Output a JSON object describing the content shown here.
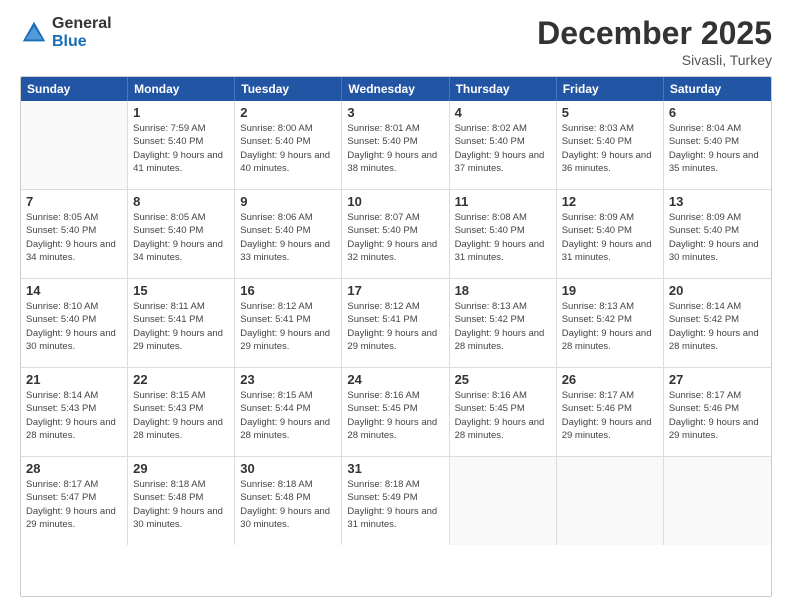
{
  "header": {
    "logo_general": "General",
    "logo_blue": "Blue",
    "month_title": "December 2025",
    "location": "Sivasli, Turkey"
  },
  "weekdays": [
    "Sunday",
    "Monday",
    "Tuesday",
    "Wednesday",
    "Thursday",
    "Friday",
    "Saturday"
  ],
  "weeks": [
    [
      {
        "day": "",
        "sunrise": "",
        "sunset": "",
        "daylight": ""
      },
      {
        "day": "1",
        "sunrise": "Sunrise: 7:59 AM",
        "sunset": "Sunset: 5:40 PM",
        "daylight": "Daylight: 9 hours and 41 minutes."
      },
      {
        "day": "2",
        "sunrise": "Sunrise: 8:00 AM",
        "sunset": "Sunset: 5:40 PM",
        "daylight": "Daylight: 9 hours and 40 minutes."
      },
      {
        "day": "3",
        "sunrise": "Sunrise: 8:01 AM",
        "sunset": "Sunset: 5:40 PM",
        "daylight": "Daylight: 9 hours and 38 minutes."
      },
      {
        "day": "4",
        "sunrise": "Sunrise: 8:02 AM",
        "sunset": "Sunset: 5:40 PM",
        "daylight": "Daylight: 9 hours and 37 minutes."
      },
      {
        "day": "5",
        "sunrise": "Sunrise: 8:03 AM",
        "sunset": "Sunset: 5:40 PM",
        "daylight": "Daylight: 9 hours and 36 minutes."
      },
      {
        "day": "6",
        "sunrise": "Sunrise: 8:04 AM",
        "sunset": "Sunset: 5:40 PM",
        "daylight": "Daylight: 9 hours and 35 minutes."
      }
    ],
    [
      {
        "day": "7",
        "sunrise": "Sunrise: 8:05 AM",
        "sunset": "Sunset: 5:40 PM",
        "daylight": "Daylight: 9 hours and 34 minutes."
      },
      {
        "day": "8",
        "sunrise": "Sunrise: 8:05 AM",
        "sunset": "Sunset: 5:40 PM",
        "daylight": "Daylight: 9 hours and 34 minutes."
      },
      {
        "day": "9",
        "sunrise": "Sunrise: 8:06 AM",
        "sunset": "Sunset: 5:40 PM",
        "daylight": "Daylight: 9 hours and 33 minutes."
      },
      {
        "day": "10",
        "sunrise": "Sunrise: 8:07 AM",
        "sunset": "Sunset: 5:40 PM",
        "daylight": "Daylight: 9 hours and 32 minutes."
      },
      {
        "day": "11",
        "sunrise": "Sunrise: 8:08 AM",
        "sunset": "Sunset: 5:40 PM",
        "daylight": "Daylight: 9 hours and 31 minutes."
      },
      {
        "day": "12",
        "sunrise": "Sunrise: 8:09 AM",
        "sunset": "Sunset: 5:40 PM",
        "daylight": "Daylight: 9 hours and 31 minutes."
      },
      {
        "day": "13",
        "sunrise": "Sunrise: 8:09 AM",
        "sunset": "Sunset: 5:40 PM",
        "daylight": "Daylight: 9 hours and 30 minutes."
      }
    ],
    [
      {
        "day": "14",
        "sunrise": "Sunrise: 8:10 AM",
        "sunset": "Sunset: 5:40 PM",
        "daylight": "Daylight: 9 hours and 30 minutes."
      },
      {
        "day": "15",
        "sunrise": "Sunrise: 8:11 AM",
        "sunset": "Sunset: 5:41 PM",
        "daylight": "Daylight: 9 hours and 29 minutes."
      },
      {
        "day": "16",
        "sunrise": "Sunrise: 8:12 AM",
        "sunset": "Sunset: 5:41 PM",
        "daylight": "Daylight: 9 hours and 29 minutes."
      },
      {
        "day": "17",
        "sunrise": "Sunrise: 8:12 AM",
        "sunset": "Sunset: 5:41 PM",
        "daylight": "Daylight: 9 hours and 29 minutes."
      },
      {
        "day": "18",
        "sunrise": "Sunrise: 8:13 AM",
        "sunset": "Sunset: 5:42 PM",
        "daylight": "Daylight: 9 hours and 28 minutes."
      },
      {
        "day": "19",
        "sunrise": "Sunrise: 8:13 AM",
        "sunset": "Sunset: 5:42 PM",
        "daylight": "Daylight: 9 hours and 28 minutes."
      },
      {
        "day": "20",
        "sunrise": "Sunrise: 8:14 AM",
        "sunset": "Sunset: 5:42 PM",
        "daylight": "Daylight: 9 hours and 28 minutes."
      }
    ],
    [
      {
        "day": "21",
        "sunrise": "Sunrise: 8:14 AM",
        "sunset": "Sunset: 5:43 PM",
        "daylight": "Daylight: 9 hours and 28 minutes."
      },
      {
        "day": "22",
        "sunrise": "Sunrise: 8:15 AM",
        "sunset": "Sunset: 5:43 PM",
        "daylight": "Daylight: 9 hours and 28 minutes."
      },
      {
        "day": "23",
        "sunrise": "Sunrise: 8:15 AM",
        "sunset": "Sunset: 5:44 PM",
        "daylight": "Daylight: 9 hours and 28 minutes."
      },
      {
        "day": "24",
        "sunrise": "Sunrise: 8:16 AM",
        "sunset": "Sunset: 5:45 PM",
        "daylight": "Daylight: 9 hours and 28 minutes."
      },
      {
        "day": "25",
        "sunrise": "Sunrise: 8:16 AM",
        "sunset": "Sunset: 5:45 PM",
        "daylight": "Daylight: 9 hours and 28 minutes."
      },
      {
        "day": "26",
        "sunrise": "Sunrise: 8:17 AM",
        "sunset": "Sunset: 5:46 PM",
        "daylight": "Daylight: 9 hours and 29 minutes."
      },
      {
        "day": "27",
        "sunrise": "Sunrise: 8:17 AM",
        "sunset": "Sunset: 5:46 PM",
        "daylight": "Daylight: 9 hours and 29 minutes."
      }
    ],
    [
      {
        "day": "28",
        "sunrise": "Sunrise: 8:17 AM",
        "sunset": "Sunset: 5:47 PM",
        "daylight": "Daylight: 9 hours and 29 minutes."
      },
      {
        "day": "29",
        "sunrise": "Sunrise: 8:18 AM",
        "sunset": "Sunset: 5:48 PM",
        "daylight": "Daylight: 9 hours and 30 minutes."
      },
      {
        "day": "30",
        "sunrise": "Sunrise: 8:18 AM",
        "sunset": "Sunset: 5:48 PM",
        "daylight": "Daylight: 9 hours and 30 minutes."
      },
      {
        "day": "31",
        "sunrise": "Sunrise: 8:18 AM",
        "sunset": "Sunset: 5:49 PM",
        "daylight": "Daylight: 9 hours and 31 minutes."
      },
      {
        "day": "",
        "sunrise": "",
        "sunset": "",
        "daylight": ""
      },
      {
        "day": "",
        "sunrise": "",
        "sunset": "",
        "daylight": ""
      },
      {
        "day": "",
        "sunrise": "",
        "sunset": "",
        "daylight": ""
      }
    ]
  ]
}
